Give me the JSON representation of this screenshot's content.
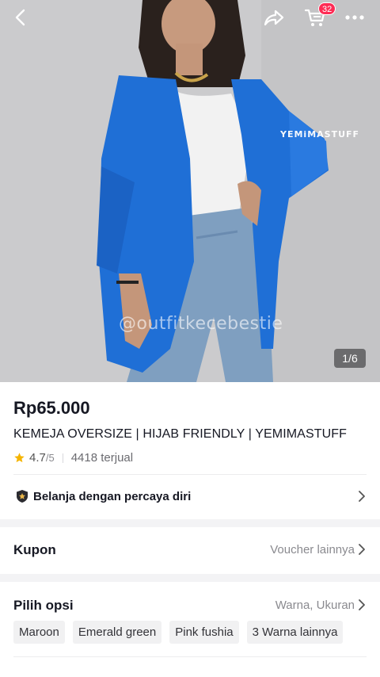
{
  "header": {
    "back_icon": "chevron-left-icon",
    "share_icon": "share-arrow-icon",
    "cart_icon": "shopping-cart-icon",
    "cart_count": "32",
    "more_icon": "more-horizontal-icon"
  },
  "gallery": {
    "watermark_brand": "YEMiMASTUFF",
    "watermark_user": "@outfitkecebestie",
    "counter": "1/6"
  },
  "product": {
    "price": "Rp65.000",
    "title": "KEMEJA OVERSIZE | HIJAB FRIENDLY | YEMIMASTUFF",
    "rating": "4.7",
    "rating_max": "/5",
    "sold": "4418 terjual"
  },
  "trust": {
    "text": "Belanja dengan percaya diri"
  },
  "coupon": {
    "label": "Kupon",
    "action": "Voucher lainnya"
  },
  "options": {
    "label": "Pilih opsi",
    "summary": "Warna, Ukuran",
    "chips": [
      "Maroon",
      "Emerald green",
      "Pink fushia",
      "3 Warna lainnya"
    ]
  },
  "colors": {
    "accent": "#fe2c55",
    "star": "#f5b400",
    "shirt": "#1f6fd6"
  }
}
